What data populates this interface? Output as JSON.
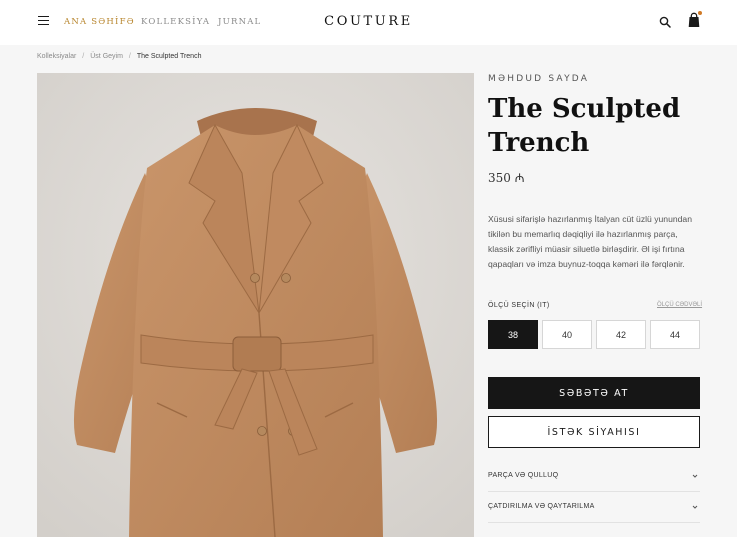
{
  "header": {
    "nav": [
      "ANA SƏHİFƏ",
      "KOLLEKSİYA",
      "JURNAL"
    ],
    "logo": "COUTURE",
    "accent_color": "#b8862e",
    "icons": [
      "menu-icon",
      "search-icon",
      "shopping-bag-icon"
    ]
  },
  "breadcrumb": {
    "items": [
      "Kolleksiyalar",
      "Üst Geyim",
      "The Sculpted Trench"
    ],
    "separator": "/"
  },
  "product": {
    "eyebrow": "MƏHDUD SAYDA",
    "title": "The Sculpted Trench",
    "price": "350 ₼",
    "description": "Xüsusi sifarişlə hazırlanmış İtalyan cüt üzlü yunundan tikilən bu memarlıq dəqiqliyi ilə hazırlanmış parça, klassik zərifliyi müasir siluetlə birləşdirir. Əl işi fırtına qapaqları və imza buynuz-toqqa kəməri ilə fərqlənir.",
    "size_label": "ÖLÇÜ SEÇİN (IT)",
    "size_guide": "ÖLÇÜ CƏDVƏLİ",
    "sizes": [
      "38",
      "40",
      "42",
      "44"
    ],
    "selected_size": "38",
    "add_to_cart": "SƏBƏTƏ AT",
    "wishlist": "İSTƏK SİYAHISI"
  },
  "accordion": [
    "PARÇA VƏ QULLUQ",
    "ÇATDIRILMA VƏ QAYTARILMA"
  ]
}
